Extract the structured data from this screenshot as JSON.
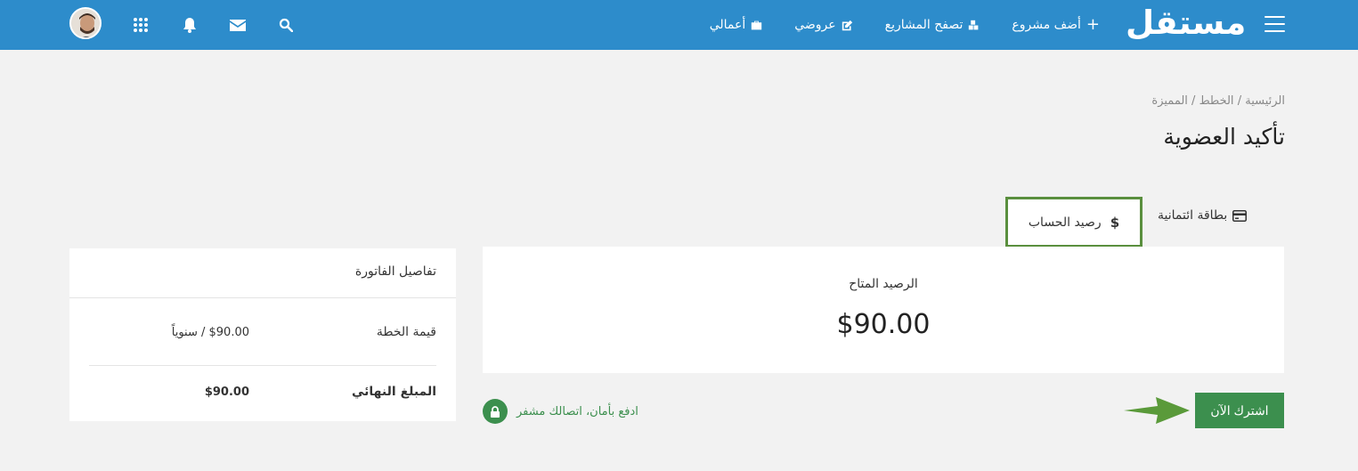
{
  "nav": {
    "logo": "مستقل",
    "links": [
      {
        "label": "أضف مشروع",
        "icon": "plus-icon"
      },
      {
        "label": "تصفح المشاريع",
        "icon": "cubes-icon"
      },
      {
        "label": "عروضي",
        "icon": "edit-icon"
      },
      {
        "label": "أعمالي",
        "icon": "briefcase-icon"
      }
    ]
  },
  "breadcrumb": {
    "home": "الرئيسية",
    "plans": "الخطط",
    "current": "المميزة",
    "separator": "/"
  },
  "page_title": "تأكيد العضوية",
  "tabs": {
    "credit_card": "بطاقة ائتمانية",
    "balance": "رصيد الحساب"
  },
  "balance": {
    "label": "الرصيد المتاح",
    "amount": "$90.00"
  },
  "subscribe_label": "اشترك الآن",
  "secure_text": "ادفع بأمان، اتصالك مشفر",
  "invoice": {
    "title": "تفاصيل الفاتورة",
    "plan_value_label": "قيمة الخطة",
    "plan_value": "$90.00 / سنوياً",
    "total_label": "المبلغ النهائي",
    "total_value": "$90.00"
  },
  "colors": {
    "navbar": "#2d8ccb",
    "accent_green": "#3c8f4e",
    "highlight_border": "#5a8f3e"
  }
}
